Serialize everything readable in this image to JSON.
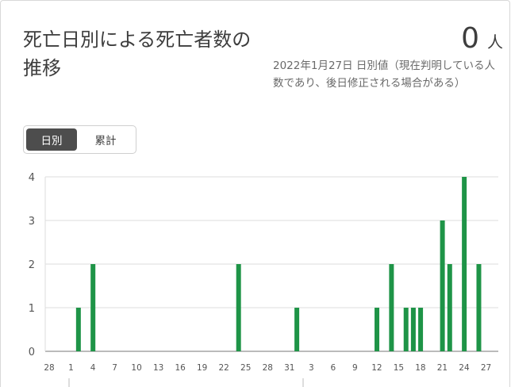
{
  "header": {
    "title": "死亡日別による死亡者数の推移",
    "value": "0",
    "unit": "人",
    "note": "2022年1月27日 日別値（現在判明している人数であり、後日修正される場合がある）"
  },
  "toggle": {
    "daily_label": "日別",
    "cumulative_label": "累計",
    "selected": "日別"
  },
  "colors": {
    "bar": "#1e9447",
    "grid": "#dddddd",
    "axis": "#777777"
  },
  "chart_data": {
    "type": "bar",
    "title": "",
    "xlabel": "",
    "ylabel": "",
    "ylim": [
      0,
      4
    ],
    "yticks": [
      "0",
      "1",
      "2",
      "3",
      "4"
    ],
    "grid": true,
    "x_tick_labels": [
      "28",
      "1",
      "4",
      "7",
      "10",
      "13",
      "16",
      "19",
      "22",
      "25",
      "28",
      "31",
      "3",
      "6",
      "9",
      "12",
      "15",
      "18",
      "21",
      "24",
      "27"
    ],
    "categories": [
      "11/28",
      "11/29",
      "11/30",
      "12/1",
      "12/2",
      "12/3",
      "12/4",
      "12/5",
      "12/6",
      "12/7",
      "12/8",
      "12/9",
      "12/10",
      "12/11",
      "12/12",
      "12/13",
      "12/14",
      "12/15",
      "12/16",
      "12/17",
      "12/18",
      "12/19",
      "12/20",
      "12/21",
      "12/22",
      "12/23",
      "12/24",
      "12/25",
      "12/26",
      "12/27",
      "12/28",
      "12/29",
      "12/30",
      "12/31",
      "1/1",
      "1/2",
      "1/3",
      "1/4",
      "1/5",
      "1/6",
      "1/7",
      "1/8",
      "1/9",
      "1/10",
      "1/11",
      "1/12",
      "1/13",
      "1/14",
      "1/15",
      "1/16",
      "1/17",
      "1/18",
      "1/19",
      "1/20",
      "1/21",
      "1/22",
      "1/23",
      "1/24",
      "1/25",
      "1/26",
      "1/27"
    ],
    "values": [
      0,
      0,
      1,
      0,
      2,
      0,
      0,
      0,
      0,
      0,
      0,
      0,
      0,
      0,
      0,
      0,
      0,
      0,
      0,
      0,
      0,
      0,
      0,
      0,
      2,
      0,
      0,
      0,
      0,
      0,
      0,
      0,
      1,
      0,
      0,
      0,
      0,
      0,
      0,
      0,
      0,
      0,
      0,
      1,
      0,
      2,
      0,
      1,
      1,
      1,
      0,
      0,
      3,
      2,
      0,
      4,
      0,
      2,
      0,
      0,
      0
    ]
  }
}
